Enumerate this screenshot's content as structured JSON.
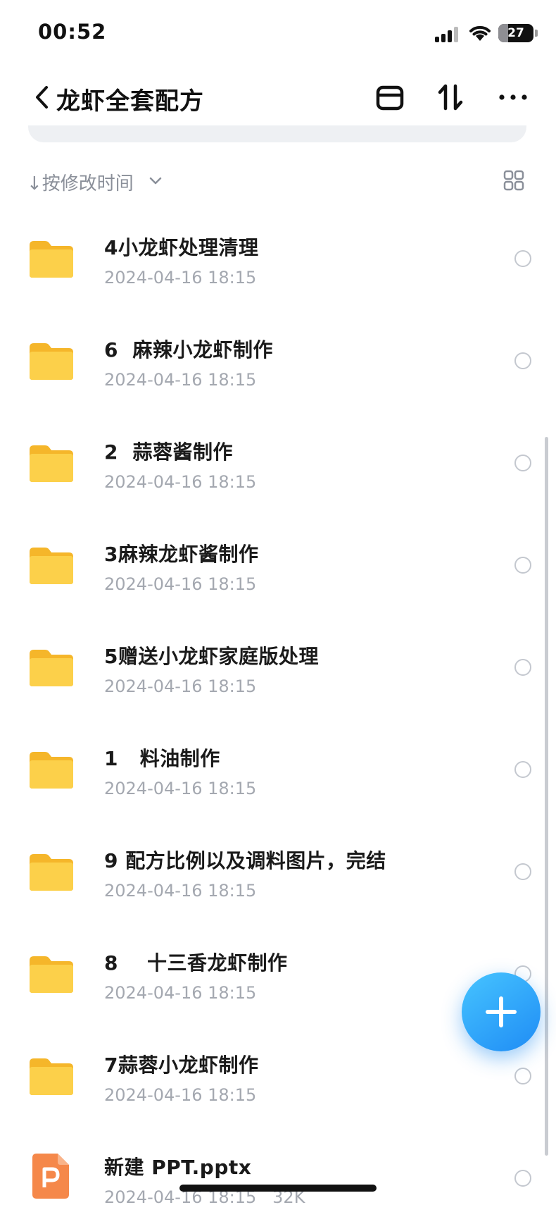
{
  "status_bar": {
    "time": "00:52",
    "battery": "27",
    "battery_fraction": 0.27
  },
  "header": {
    "title": "龙虾全套配方",
    "icons": [
      "back-icon",
      "select-mode-icon",
      "sort-icon",
      "more-icon"
    ]
  },
  "sort_bar": {
    "label": "↓按修改时间",
    "view_toggle_icon": "grid-view-icon"
  },
  "files": [
    {
      "name": "4小龙虾处理清理",
      "meta": "2024-04-16 18:15",
      "type": "folder"
    },
    {
      "name": "6  麻辣小龙虾制作",
      "meta": "2024-04-16 18:15",
      "type": "folder"
    },
    {
      "name": "2  蒜蓉酱制作",
      "meta": "2024-04-16 18:15",
      "type": "folder"
    },
    {
      "name": "3麻辣龙虾酱制作",
      "meta": "2024-04-16 18:15",
      "type": "folder"
    },
    {
      "name": "5赠送小龙虾家庭版处理",
      "meta": "2024-04-16 18:15",
      "type": "folder"
    },
    {
      "name": "1   料油制作",
      "meta": "2024-04-16 18:15",
      "type": "folder"
    },
    {
      "name": "9 配方比例以及调料图片，完结",
      "meta": "2024-04-16 18:15",
      "type": "folder"
    },
    {
      "name": "8    十三香龙虾制作",
      "meta": "2024-04-16 18:15",
      "type": "folder"
    },
    {
      "name": "7蒜蓉小龙虾制作",
      "meta": "2024-04-16 18:15",
      "type": "folder"
    },
    {
      "name": "新建 PPT.pptx",
      "meta": "2024-04-16 18:15   32K",
      "type": "pptx"
    }
  ],
  "colors": {
    "accent": "#1f8cf5",
    "folder": "#fcc93a",
    "ppt": "#f5884a"
  }
}
